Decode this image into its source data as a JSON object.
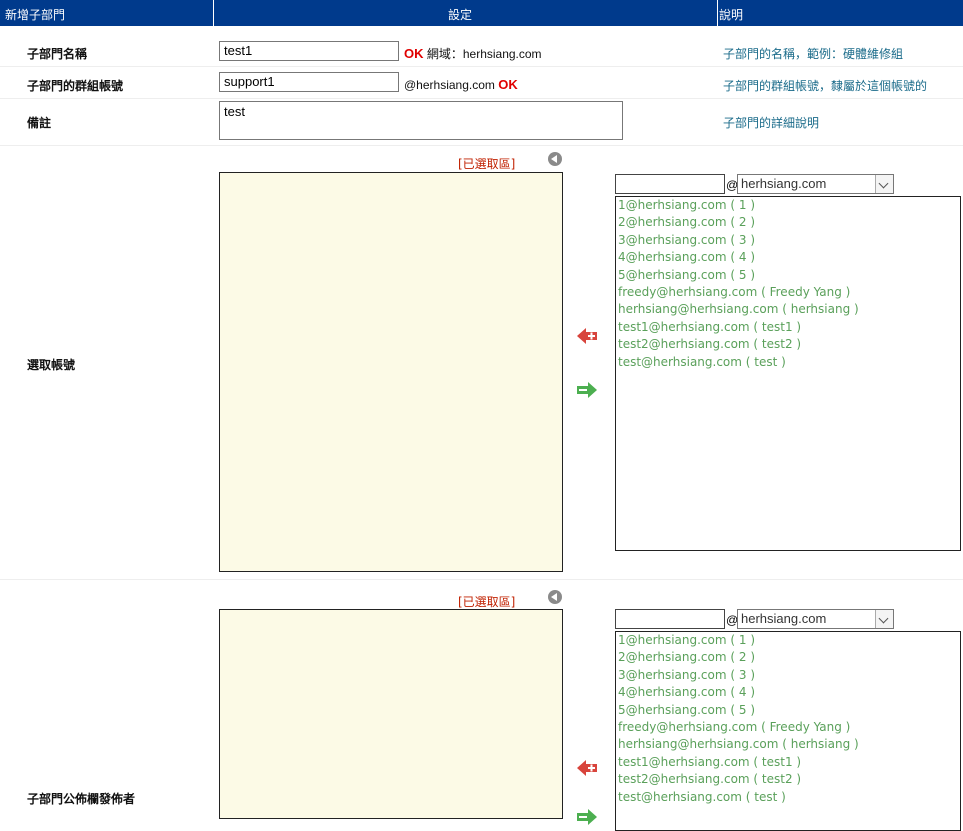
{
  "header": {
    "col1": "新增子部門",
    "col2": "設定",
    "col3": "說明"
  },
  "rows": {
    "name": {
      "label": "子部門名稱",
      "value": "test1",
      "ok": "OK",
      "domain_text": "網域：herhsiang.com",
      "desc": "子部門的名稱，範例：硬體維修組"
    },
    "group_account": {
      "label": "子部門的群組帳號",
      "value": "support1",
      "suffix": "@herhsiang.com",
      "ok": "OK",
      "desc": "子部門的群組帳號，隸屬於這個帳號的"
    },
    "note": {
      "label": "備註",
      "value": "test",
      "desc": "子部門的詳細說明"
    },
    "select_accounts": {
      "label": "選取帳號",
      "selected_zone_label": "[已選取區]",
      "at": "@",
      "domain": "herhsiang.com",
      "options": [
        "1@herhsiang.com ( 1 )",
        "2@herhsiang.com ( 2 )",
        "3@herhsiang.com ( 3 )",
        "4@herhsiang.com ( 4 )",
        "5@herhsiang.com ( 5 )",
        "freedy@herhsiang.com ( Freedy Yang )",
        "herhsiang@herhsiang.com ( herhsiang )",
        "test1@herhsiang.com ( test1 )",
        "test2@herhsiang.com ( test2 )",
        "test@herhsiang.com ( test )"
      ]
    },
    "publishers": {
      "label": "子部門公佈欄發佈者",
      "selected_zone_label": "[已選取區]",
      "at": "@",
      "domain": "herhsiang.com",
      "options": [
        "1@herhsiang.com ( 1 )",
        "2@herhsiang.com ( 2 )",
        "3@herhsiang.com ( 3 )",
        "4@herhsiang.com ( 4 )",
        "5@herhsiang.com ( 5 )",
        "freedy@herhsiang.com ( Freedy Yang )",
        "herhsiang@herhsiang.com ( herhsiang )",
        "test1@herhsiang.com ( test1 )",
        "test2@herhsiang.com ( test2 )",
        "test@herhsiang.com ( test )"
      ]
    }
  },
  "icons": {
    "add": "red-plus-arrow-icon",
    "remove": "green-minus-arrow-icon",
    "back": "gray-back-circle-icon"
  }
}
